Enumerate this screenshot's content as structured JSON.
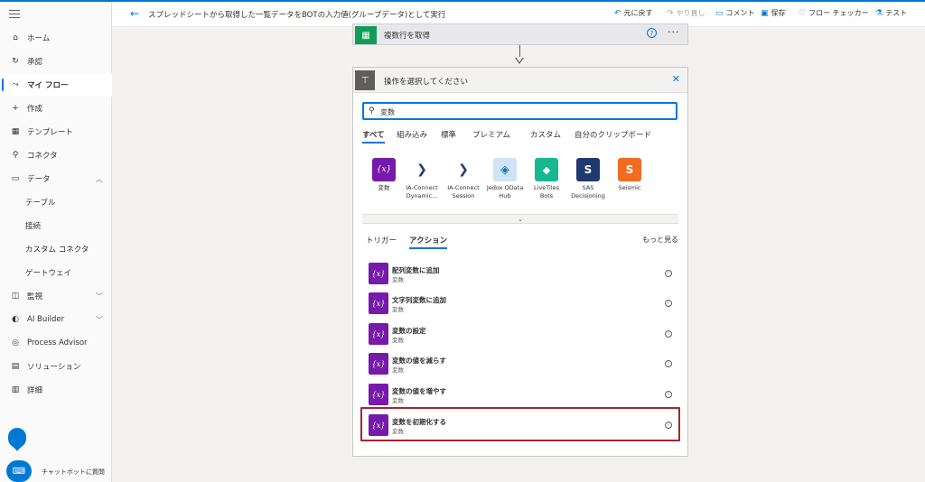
{
  "colors": {
    "accent": "#0078d4",
    "variable": "#7719aa",
    "highlight": "#a4262c"
  },
  "sidebar": {
    "items": [
      {
        "icon": "home-icon",
        "glyph": "⌂",
        "label": "ホーム"
      },
      {
        "icon": "approval-icon",
        "glyph": "↻",
        "label": "承認"
      },
      {
        "icon": "flow-icon",
        "glyph": "⤳",
        "label": "マイ フロー"
      },
      {
        "icon": "plus-icon",
        "glyph": "+",
        "label": "作成"
      },
      {
        "icon": "template-icon",
        "glyph": "▦",
        "label": "テンプレート"
      },
      {
        "icon": "connector-icon",
        "glyph": "⚲",
        "label": "コネクタ"
      },
      {
        "icon": "database-icon",
        "glyph": "▭",
        "label": "データ"
      },
      {
        "label": "テーブル"
      },
      {
        "label": "接続"
      },
      {
        "label": "カスタム コネクタ"
      },
      {
        "label": "ゲートウェイ"
      },
      {
        "icon": "monitor-icon",
        "glyph": "◫",
        "label": "監視"
      },
      {
        "icon": "ai-builder-icon",
        "glyph": "◐",
        "label": "AI Builder"
      },
      {
        "icon": "process-advisor-icon",
        "glyph": "◎",
        "label": "Process Advisor"
      },
      {
        "icon": "solution-icon",
        "glyph": "▤",
        "label": "ソリューション"
      },
      {
        "icon": "book-icon",
        "glyph": "▥",
        "label": "詳細"
      }
    ],
    "chatbot_label": "チャットボットに質問"
  },
  "header": {
    "title": "スプレッドシートから取得した一覧データをBOTの入力値(グループデータ)として実行",
    "undo": "元に戻す",
    "redo": "やり直し",
    "comment": "コメント",
    "save": "保存",
    "flow_checker": "フロー チェッカー",
    "test": "テスト"
  },
  "step_card": {
    "title": "複数行を取得",
    "more": "···",
    "help": "?"
  },
  "panel": {
    "title": "操作を選択してください",
    "search_value": "変数",
    "tabs": [
      "すべて",
      "組み込み",
      "標準",
      "プレミアム",
      "カスタム",
      "自分のクリップボード"
    ],
    "connectors": [
      {
        "name": "変数",
        "glyph": "{x}",
        "color": "#7719aa"
      },
      {
        "name": "IA-Connect Dynamic...",
        "glyph": "❯",
        "color": "#ffffff"
      },
      {
        "name": "IA-Connect Session",
        "glyph": "❯",
        "color": "#ffffff"
      },
      {
        "name": "Jedox OData Hub",
        "glyph": "◈",
        "color": "#d0e4f5"
      },
      {
        "name": "LiveTiles Bots",
        "glyph": "◆",
        "color": "#17b890"
      },
      {
        "name": "SAS Decisioning",
        "glyph": "S",
        "color": "#1f3a6e"
      },
      {
        "name": "Seismic",
        "glyph": "S",
        "color": "#f26b21"
      }
    ],
    "action_tabs": [
      "トリガー",
      "アクション"
    ],
    "see_more": "もっと見る",
    "actions": [
      {
        "name": "配列変数に追加",
        "sub": "変数"
      },
      {
        "name": "文字列変数に追加",
        "sub": "変数"
      },
      {
        "name": "変数の設定",
        "sub": "変数"
      },
      {
        "name": "変数の値を減らす",
        "sub": "変数"
      },
      {
        "name": "変数の値を増やす",
        "sub": "変数"
      },
      {
        "name": "変数を初期化する",
        "sub": "変数"
      }
    ]
  }
}
